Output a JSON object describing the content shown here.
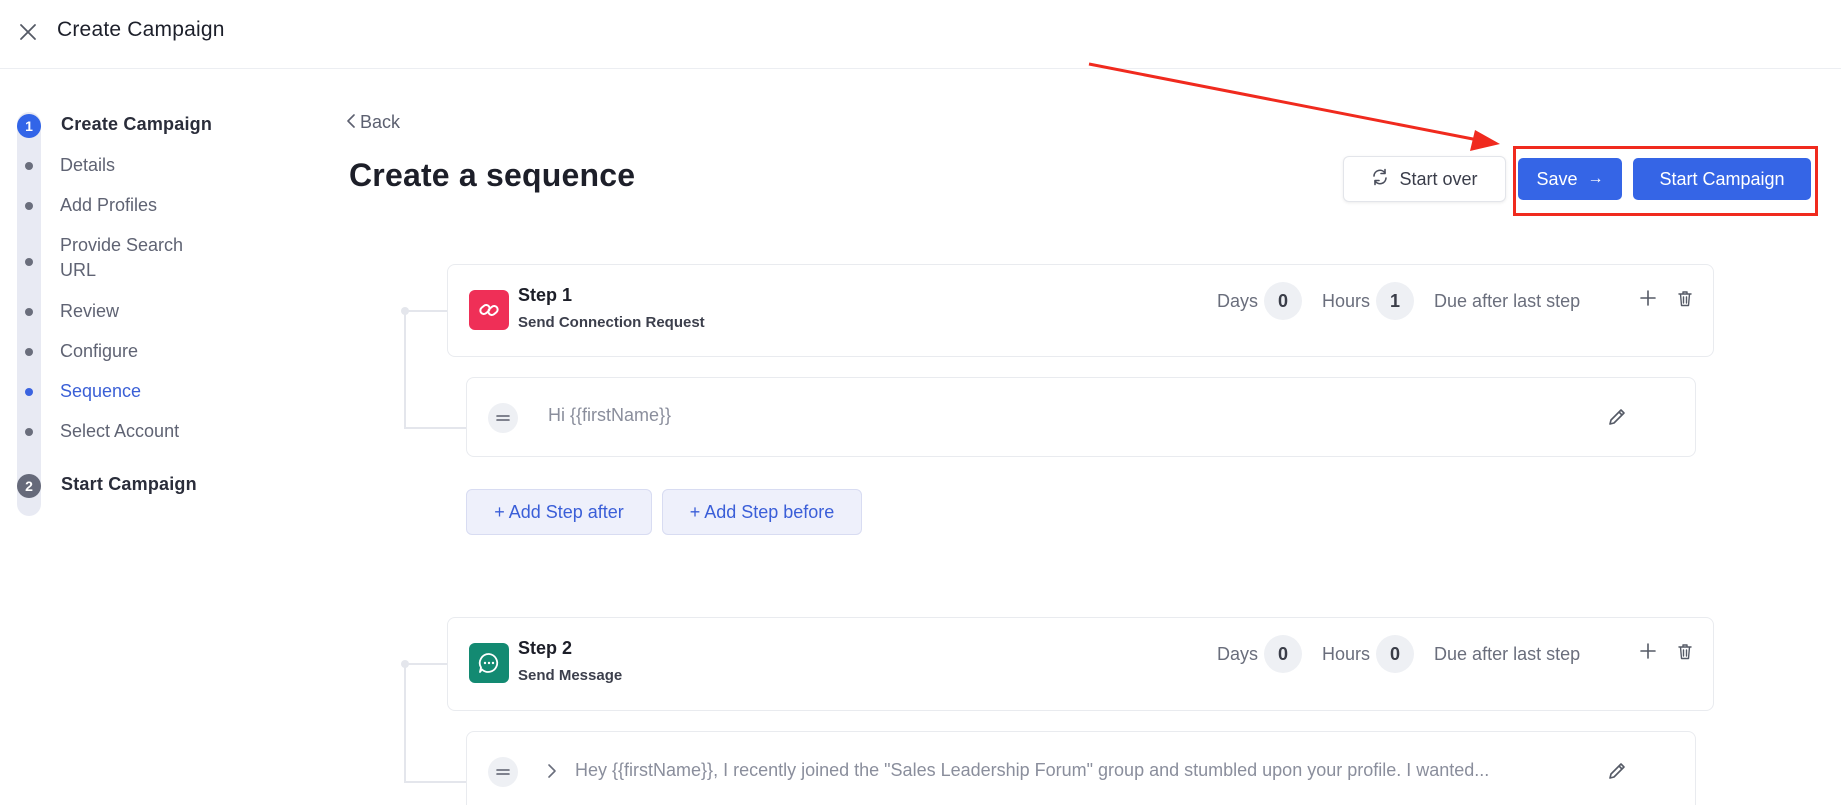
{
  "header": {
    "title": "Create Campaign"
  },
  "sidebar": {
    "sections": [
      {
        "number": "1",
        "title": "Create Campaign"
      },
      {
        "number": "2",
        "title": "Start Campaign"
      }
    ],
    "items": [
      {
        "label": "Details"
      },
      {
        "label": "Add Profiles"
      },
      {
        "label": "Provide Search URL"
      },
      {
        "label": "Review"
      },
      {
        "label": "Configure"
      },
      {
        "label": "Sequence",
        "current": true
      },
      {
        "label": "Select Account"
      }
    ]
  },
  "main": {
    "back_label": "Back",
    "title": "Create a sequence",
    "actions": {
      "start_over": "Start over",
      "save": "Save",
      "save_arrow": "→",
      "start_campaign": "Start Campaign"
    }
  },
  "steps": [
    {
      "title": "Step 1",
      "subtitle": "Send Connection Request",
      "icon": "link-icon",
      "icon_color": "#ef2f57",
      "days_label": "Days",
      "days": "0",
      "hours_label": "Hours",
      "hours": "1",
      "due_label": "Due after last step",
      "message": "Hi {{firstName}}"
    },
    {
      "title": "Step 2",
      "subtitle": "Send Message",
      "icon": "chat-bubble-icon",
      "icon_color": "#138a72",
      "days_label": "Days",
      "days": "0",
      "hours_label": "Hours",
      "hours": "0",
      "due_label": "Due after last step",
      "message": "Hey {{firstName}}, I recently joined the \"Sales Leadership Forum\" group and stumbled upon your profile. I wanted..."
    }
  ],
  "add_step": {
    "after": "+ Add Step after",
    "before": "+ Add Step before"
  },
  "colors": {
    "primary": "#3565e6",
    "annotation": "#f02a1e"
  }
}
